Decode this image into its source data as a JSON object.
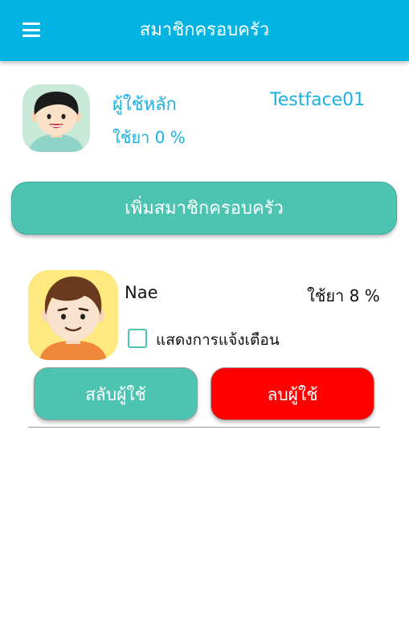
{
  "colors": {
    "app_bar": "#03b3e2",
    "accent_text": "#1ab0e0",
    "primary_button": "#4dc3b1",
    "danger_button": "#ff0000"
  },
  "header": {
    "menu_icon": "hamburger-menu-icon",
    "title": "สมาชิกครอบครัว"
  },
  "main_user": {
    "avatar_icon": "boy-avatar-icon",
    "role_label": "ผู้ใช้หลัก",
    "name": "Testface01",
    "usage": "ใช้ยา 0 %"
  },
  "add_member_button": "เพิ่มสมาชิกครอบครัว",
  "members": [
    {
      "avatar_icon": "man-avatar-icon",
      "name": "Nae",
      "usage": "ใช้ยา 8 %",
      "notify_label": "แสดงการแจ้งเตือน",
      "notify_checked": false,
      "switch_label": "สลับผู้ใช้",
      "delete_label": "ลบผู้ใช้"
    }
  ]
}
